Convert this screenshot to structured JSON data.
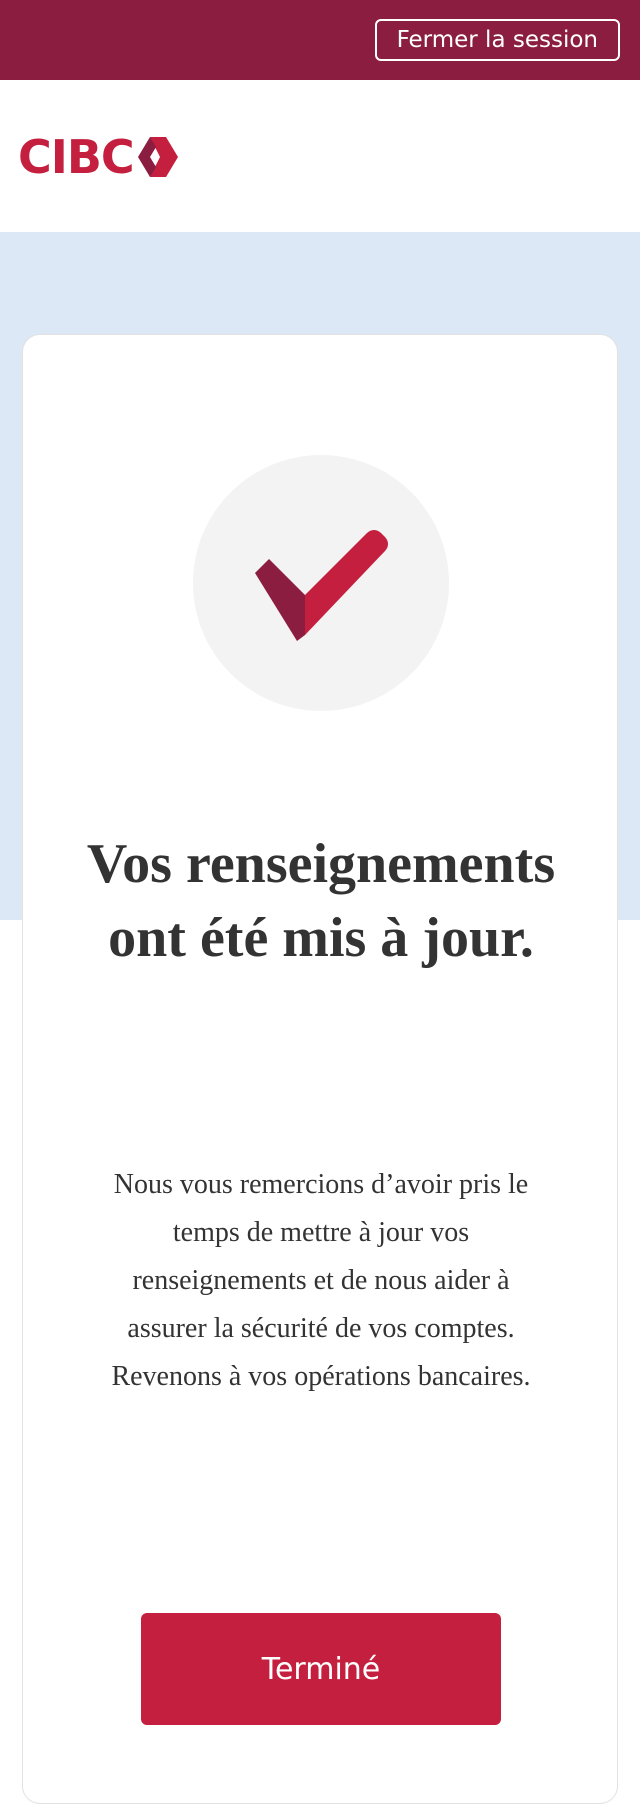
{
  "topbar": {
    "logout_label": "Fermer la session"
  },
  "header": {
    "logo_text": "CIBC"
  },
  "confirmation": {
    "title": "Vos renseignements ont été mis à jour.",
    "message": "Nous vous remercions d’avoir pris le temps de mettre à jour vos renseignements et de nous aider à assurer la sécurité de vos comptes. Revenons à vos opérations bancaires.",
    "done_label": "Terminé"
  },
  "icons": {
    "logo_mark": "cibc-diamond-icon",
    "success": "checkmark-icon"
  },
  "colors": {
    "topbar": "#8b1d41",
    "brand_red": "#c41f3e",
    "band": "#dde8f6",
    "circle": "#f3f3f3",
    "text": "#333333"
  }
}
